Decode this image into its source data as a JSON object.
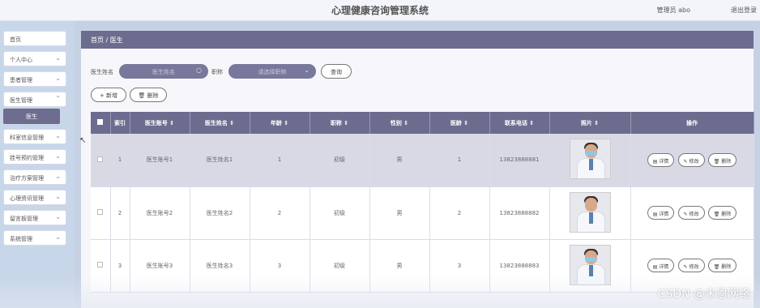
{
  "header": {
    "title": "心理健康咨询管理系统",
    "user": "管理员 abo",
    "logout": "退出登录"
  },
  "sidebar": {
    "items": [
      {
        "label": "首页",
        "chevron": false
      },
      {
        "label": "个人中心",
        "chevron": true
      },
      {
        "label": "患者管理",
        "chevron": true
      },
      {
        "label": "医生管理",
        "chevron": true
      },
      {
        "label": "科室信息管理",
        "chevron": true
      },
      {
        "label": "挂号预约管理",
        "chevron": true
      },
      {
        "label": "治疗方案管理",
        "chevron": true
      },
      {
        "label": "心理资讯管理",
        "chevron": true
      },
      {
        "label": "留言板管理",
        "chevron": true
      },
      {
        "label": "系统管理",
        "chevron": true
      }
    ],
    "subitem": "医生"
  },
  "breadcrumb": "首页 / 医生",
  "search": {
    "name_label": "医生姓名",
    "name_placeholder": "医生姓名",
    "title_label": "职称",
    "title_placeholder": "请选择职称",
    "query_button": "查询"
  },
  "actions": {
    "add": "+ 新增",
    "delete": "删除"
  },
  "table": {
    "headers": [
      "索引",
      "医生账号 ⇕",
      "医生姓名 ⇕",
      "年龄 ⇕",
      "职称 ⇕",
      "性别 ⇕",
      "医龄 ⇕",
      "联系电话 ⇕",
      "照片 ⇕",
      "操作"
    ],
    "rows": [
      {
        "index": "1",
        "account": "医生账号1",
        "name": "医生姓名1",
        "age": "1",
        "title": "初级",
        "gender": "男",
        "years": "1",
        "phone": "13823888881"
      },
      {
        "index": "2",
        "account": "医生账号2",
        "name": "医生姓名2",
        "age": "2",
        "title": "初级",
        "gender": "男",
        "years": "2",
        "phone": "13823888882"
      },
      {
        "index": "3",
        "account": "医生账号3",
        "name": "医生姓名3",
        "age": "3",
        "title": "初级",
        "gender": "男",
        "years": "3",
        "phone": "13823888883"
      }
    ],
    "ops": {
      "detail": "详情",
      "edit": "修改",
      "delete": "删除"
    }
  },
  "watermark": "CSDN @米恩网络",
  "colors": {
    "accent": "#6c6c8f",
    "sidebar_bg": "#c8d6ea"
  }
}
